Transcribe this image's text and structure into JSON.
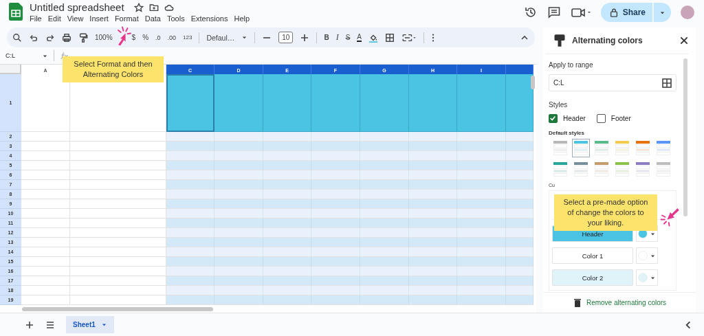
{
  "app": {
    "title": "Untitled spreadsheet",
    "menu": [
      "File",
      "Edit",
      "View",
      "Insert",
      "Format",
      "Data",
      "Tools",
      "Extensions",
      "Help"
    ],
    "share": "Share"
  },
  "toolbar": {
    "zoom": "100%",
    "currency": "$",
    "percent": "%",
    "decrease_decimals": ".0",
    "increase_decimals": ".00",
    "number_format": "123",
    "font": "Defaul…",
    "font_size": "10",
    "bold": "B",
    "italic": "I",
    "strikethrough": "S",
    "text_color": "A"
  },
  "formula_bar": {
    "name_box": "C:L"
  },
  "sheet": {
    "columns": [
      {
        "label": "A",
        "selected": false
      },
      {
        "selected": false
      },
      {
        "label": "C",
        "selected": true
      },
      {
        "label": "D",
        "selected": true
      },
      {
        "label": "E",
        "selected": true
      },
      {
        "label": "F",
        "selected": true
      },
      {
        "label": "G",
        "selected": true
      },
      {
        "label": "H",
        "selected": true
      },
      {
        "label": "I",
        "selected": true
      },
      {
        "selected": true
      }
    ],
    "rows": [
      "1",
      "2",
      "3",
      "4",
      "5",
      "6",
      "7",
      "8",
      "9",
      "10",
      "11",
      "12",
      "13",
      "14",
      "15",
      "16",
      "17",
      "18",
      "19"
    ]
  },
  "sheet_tabs": [
    {
      "label": "Sheet1",
      "selected": true
    }
  ],
  "panel": {
    "title": "Alternating colors",
    "range_label": "Apply to range",
    "range": "C:L",
    "styles_label": "Styles",
    "options": [
      {
        "label": "Header",
        "checked": true
      },
      {
        "label": "Footer",
        "checked": false
      }
    ],
    "default_styles_label": "Default styles",
    "default_styles": [
      {
        "color": "#b7b7b7",
        "selected": false
      },
      {
        "color": "#4ac4e2",
        "selected": true
      },
      {
        "color": "#57bb8a",
        "selected": false
      },
      {
        "color": "#f7cb4d",
        "selected": false
      },
      {
        "color": "#e8710a",
        "selected": false
      },
      {
        "color": "#5b95f9",
        "selected": false
      },
      {
        "color": "#26a69a",
        "selected": false
      },
      {
        "color": "#78909c",
        "selected": false
      },
      {
        "color": "#c79c6c",
        "selected": false
      },
      {
        "color": "#8bc34a",
        "selected": false
      },
      {
        "color": "#8e7cc3",
        "selected": false
      },
      {
        "color": "#bdbdbd",
        "selected": false
      }
    ],
    "custom_label": "Cu",
    "custom_colors": [
      {
        "label": "Header",
        "color": "#4ac4e2"
      },
      {
        "label": "Color 1",
        "color": "#ffffff"
      },
      {
        "label": "Color 2",
        "color": "#dff3f9"
      }
    ],
    "remove": "Remove alternating colors"
  },
  "callouts": [
    {
      "text": "Select Format and then Alternating Colors"
    },
    {
      "text": "Select a pre-made option of change the colors to your liking."
    }
  ]
}
